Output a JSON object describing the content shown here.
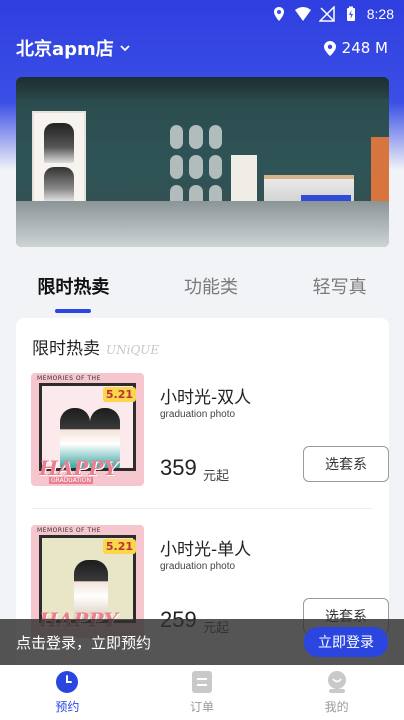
{
  "status_bar": {
    "time": "8:28"
  },
  "header": {
    "store_name": "北京apm店",
    "distance": "248 M"
  },
  "tabs": [
    {
      "label": "限时热卖",
      "active": true
    },
    {
      "label": "功能类",
      "active": false
    },
    {
      "label": "轻写真",
      "active": false
    }
  ],
  "section": {
    "title": "限时热卖",
    "subtitle": "UNiQUE"
  },
  "products": [
    {
      "name": "小时光-双人",
      "name_en": "graduation photo",
      "price": "359",
      "price_unit": "元起",
      "button": "选套系",
      "thumb_happy": "HAPPY",
      "thumb_date": "5.21",
      "thumb_top_text": "MEMORIES OF THE",
      "thumb_bottom_text": "GRADUATION"
    },
    {
      "name": "小时光-单人",
      "name_en": "graduation photo",
      "price": "259",
      "price_unit": "元起",
      "button": "选套系",
      "thumb_happy": "HAPPY",
      "thumb_date": "5.21",
      "thumb_top_text": "MEMORIES OF THE"
    }
  ],
  "login_bar": {
    "message": "点击登录，立即预约",
    "button": "立即登录"
  },
  "bottom_nav": [
    {
      "label": "预约",
      "icon": "clock-icon",
      "active": true
    },
    {
      "label": "订单",
      "icon": "order-icon",
      "active": false
    },
    {
      "label": "我的",
      "icon": "profile-icon",
      "active": false
    }
  ],
  "colors": {
    "brand_blue": "#2b46e0",
    "header_bg": "#2f3fe0"
  }
}
